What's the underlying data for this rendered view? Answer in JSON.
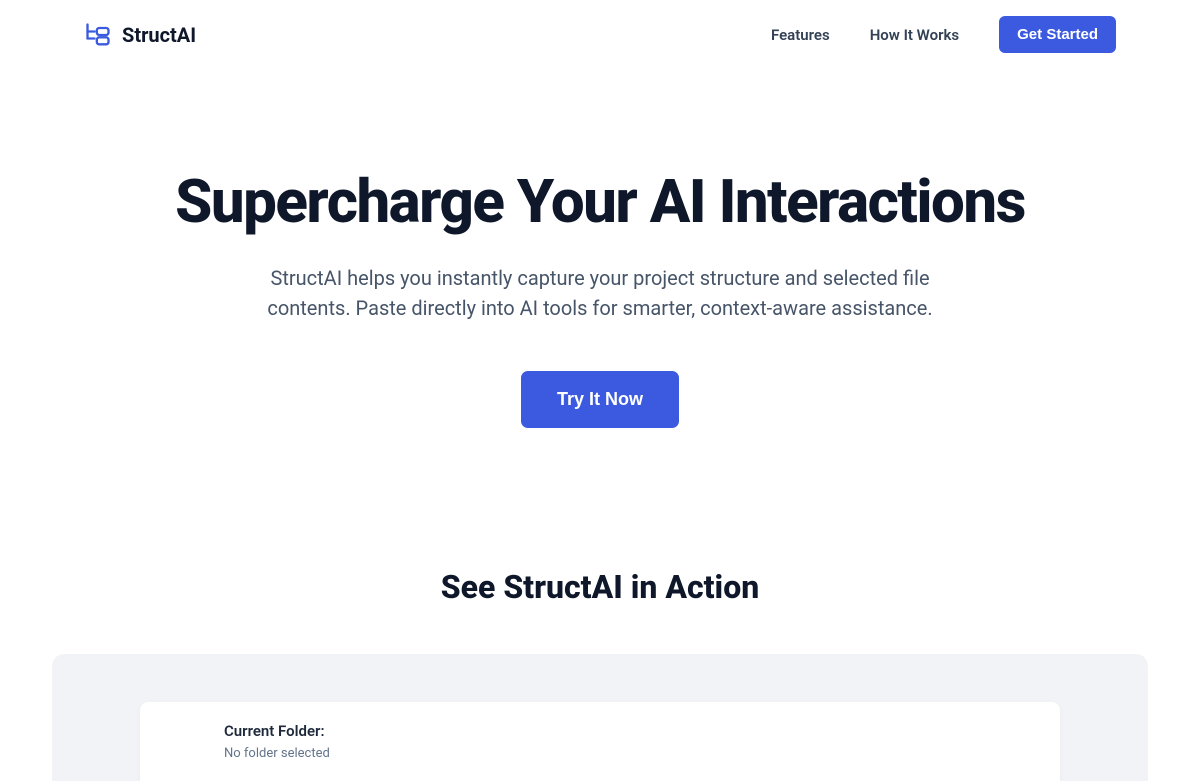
{
  "brand": {
    "name": "StructAI"
  },
  "nav": {
    "links": [
      {
        "label": "Features"
      },
      {
        "label": "How It Works"
      }
    ],
    "cta": "Get Started"
  },
  "hero": {
    "title": "Supercharge Your AI Interactions",
    "subtitle": "StructAI helps you instantly capture your project structure and selected file contents. Paste directly into AI tools for smarter, context-aware assistance.",
    "cta": "Try It Now"
  },
  "demo": {
    "heading": "See StructAI in Action",
    "currentFolderLabel": "Current Folder:",
    "currentFolderValue": "No folder selected"
  },
  "colors": {
    "primary": "#3b5ae0",
    "text": "#0f172a",
    "muted": "#64748b"
  }
}
